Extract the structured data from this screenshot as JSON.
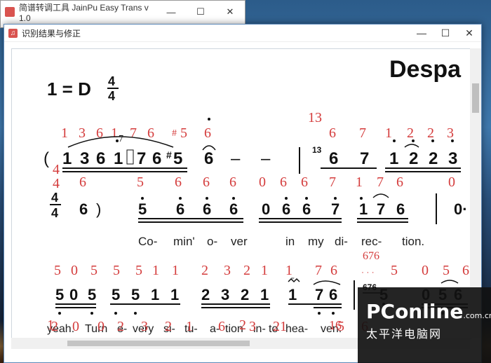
{
  "back_window": {
    "title": "简谱转调工具 JainPu Easy Trans v 1.0",
    "minimize": "—",
    "maximize": "☐",
    "close": "✕"
  },
  "front_window": {
    "title": "识别结果与修正",
    "minimize": "—",
    "maximize": "☐",
    "close": "✕"
  },
  "sheet": {
    "key": "1 = D",
    "time_top": "4",
    "time_bottom": "4",
    "title_partial": "Despa",
    "row1": {
      "open_paren": "(",
      "notes": [
        "1",
        "3",
        "6",
        "1̇",
        "7",
        "6",
        "#5",
        "6",
        "–",
        "–",
        "6",
        "7",
        "1̇",
        "2̇",
        "2̇",
        "3̇"
      ],
      "red_top": [
        "1",
        "3",
        "6",
        "1",
        "7",
        "6",
        "#5",
        "6",
        "13",
        "6",
        "7",
        "1",
        "2",
        "2",
        "3"
      ],
      "red_bottom": [
        "4",
        "4",
        "6",
        "5",
        "6",
        "6",
        "6",
        "0",
        "6",
        "6",
        "7",
        "1",
        "7",
        "6",
        "0"
      ]
    },
    "row2": {
      "time_top": "4",
      "time_bottom": "4",
      "notes": [
        "6",
        ")",
        "5",
        "6",
        "6",
        "6",
        "0",
        "6",
        "6",
        "7",
        "1",
        "7",
        "6",
        "0·"
      ],
      "lyrics": [
        "Co-",
        "min'",
        "o-",
        "ver",
        "in",
        "my",
        "di-",
        "rec-",
        "tion."
      ]
    },
    "row3": {
      "notes": [
        "5",
        "0",
        "5",
        "5",
        "5",
        "1",
        "1",
        "2",
        "3",
        "2",
        "1",
        "1",
        "7",
        "6",
        "676",
        "5",
        "0",
        "5",
        "6"
      ],
      "red_top": [
        "5",
        "0",
        "5",
        "5",
        "5",
        "1",
        "1",
        "2",
        "3",
        "2",
        "1",
        "1",
        "7",
        "6",
        "676",
        "5",
        "0",
        "5",
        "6"
      ],
      "lyrics": [
        "yeah.",
        "Turn",
        "e-",
        "very",
        "si-",
        "tu-",
        "a-",
        "tion",
        "in-",
        "to",
        "hea-",
        "ven."
      ]
    },
    "row4": {
      "red": [
        "1",
        "2",
        "0",
        "0",
        "2",
        "3",
        "2",
        "1",
        "6",
        "2",
        "3",
        "21",
        "16",
        "5",
        "6"
      ]
    }
  },
  "watermark": {
    "brand": "PConline",
    "domain_suffix": ".com.cn",
    "cn": "太平洋电脑网"
  }
}
